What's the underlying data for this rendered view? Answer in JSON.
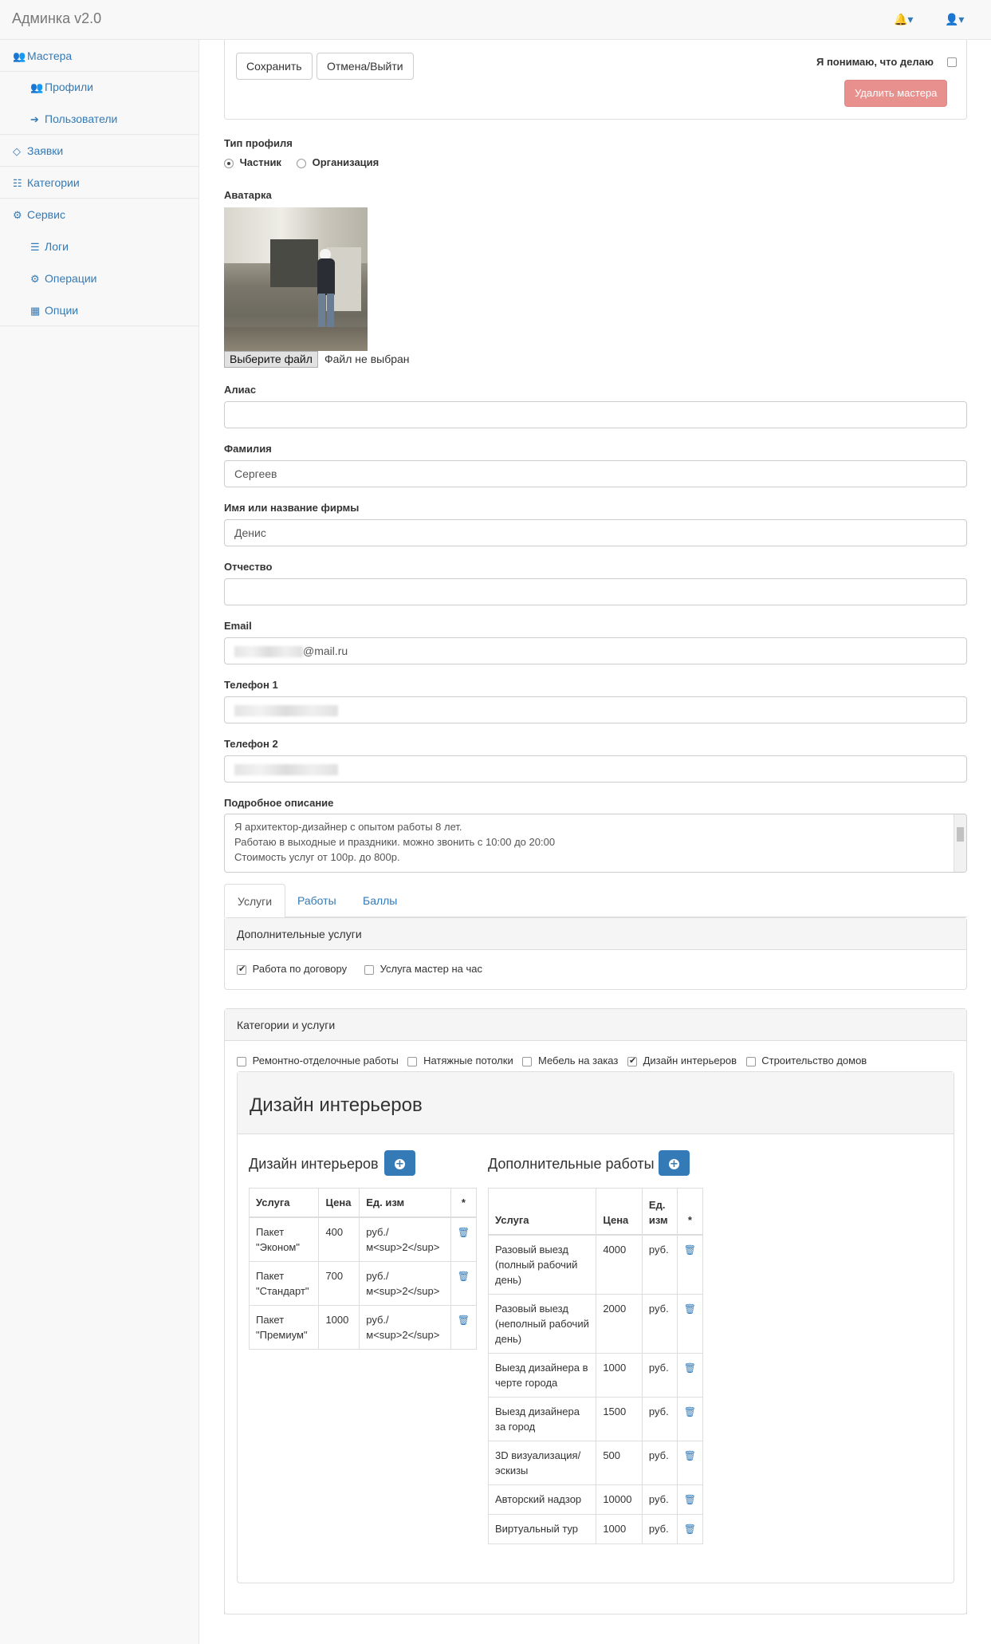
{
  "app": {
    "brand": "Админка v2.0",
    "bell_icon": "bell-icon",
    "user_icon": "user-icon"
  },
  "sidebar": {
    "items": [
      {
        "label": "Мастера",
        "icon": "users-icon"
      },
      {
        "label": "Профили",
        "icon": "users-icon"
      },
      {
        "label": "Пользователи",
        "icon": "sign-in-icon"
      },
      {
        "label": "Заявки",
        "icon": "diamond-icon"
      },
      {
        "label": "Категории",
        "icon": "sitemap-icon"
      },
      {
        "label": "Сервис",
        "icon": "cogs-icon"
      },
      {
        "label": "Логи",
        "icon": "list-icon"
      },
      {
        "label": "Операции",
        "icon": "gear-icon"
      },
      {
        "label": "Опции",
        "icon": "grid-icon"
      }
    ]
  },
  "toolbar": {
    "save_label": "Сохранить",
    "cancel_label": "Отмена/Выйти",
    "confirm_label": "Я понимаю, что делаю",
    "delete_label": "Удалить мастера"
  },
  "form": {
    "profile_type_label": "Тип профиля",
    "profile_type_options": [
      "Частник",
      "Организация"
    ],
    "profile_type_selected": "Частник",
    "avatar_label": "Аватарка",
    "file_button": "Выберите файл",
    "file_status": "Файл не выбран",
    "alias_label": "Алиас",
    "alias_value": "",
    "lastname_label": "Фамилия",
    "lastname_value": "Сергеев",
    "firstname_label": "Имя или название фирмы",
    "firstname_value": "Денис",
    "middlename_label": "Отчество",
    "middlename_value": "",
    "email_label": "Email",
    "email_suffix": "@mail.ru",
    "phone1_label": "Телефон 1",
    "phone2_label": "Телефон 2",
    "description_label": "Подробное описание",
    "description_lines": [
      "Я архитектор-дизайнер с опытом работы 8 лет.",
      "Работаю в выходные и праздники. можно звонить с 10:00 до 20:00",
      "Стоимость услуг от 100р. до 800р."
    ]
  },
  "tabs": [
    "Услуги",
    "Работы",
    "Баллы"
  ],
  "extra_services": {
    "title": "Дополнительные услуги",
    "options": [
      {
        "label": "Работа по договору",
        "checked": true
      },
      {
        "label": "Услуга мастер на час",
        "checked": false
      }
    ]
  },
  "categories": {
    "title": "Категории и услуги",
    "options": [
      {
        "label": "Ремонтно-отделочные работы",
        "checked": false
      },
      {
        "label": "Натяжные потолки",
        "checked": false
      },
      {
        "label": "Мебель на заказ",
        "checked": false
      },
      {
        "label": "Дизайн интерьеров",
        "checked": true
      },
      {
        "label": "Строительство домов",
        "checked": false
      }
    ]
  },
  "design_panel": {
    "title": "Дизайн интерьеров",
    "services_title": "Дизайн интерьеров",
    "extra_title": "Дополнительные работы",
    "columns": [
      "Услуга",
      "Цена",
      "Ед. изм",
      "*"
    ],
    "services": [
      {
        "name": "Пакет \"Эконом\"",
        "price": "400",
        "unit": "руб./ м<sup>2</sup>"
      },
      {
        "name": "Пакет \"Стандарт\"",
        "price": "700",
        "unit": "руб./ м<sup>2</sup>"
      },
      {
        "name": "Пакет \"Премиум\"",
        "price": "1000",
        "unit": "руб./ м<sup>2</sup>"
      }
    ],
    "extras": [
      {
        "name": "Разовый выезд (полный рабочий день)",
        "price": "4000",
        "unit": "руб."
      },
      {
        "name": "Разовый выезд (неполный рабочий день)",
        "price": "2000",
        "unit": "руб."
      },
      {
        "name": "Выезд дизайнера в черте города",
        "price": "1000",
        "unit": "руб."
      },
      {
        "name": "Выезд дизайнера за город",
        "price": "1500",
        "unit": "руб."
      },
      {
        "name": "3D визуализация/ эскизы",
        "price": "500",
        "unit": "руб."
      },
      {
        "name": "Авторский надзор",
        "price": "10000",
        "unit": "руб."
      },
      {
        "name": "Виртуальный тур",
        "price": "1000",
        "unit": "руб."
      }
    ]
  }
}
